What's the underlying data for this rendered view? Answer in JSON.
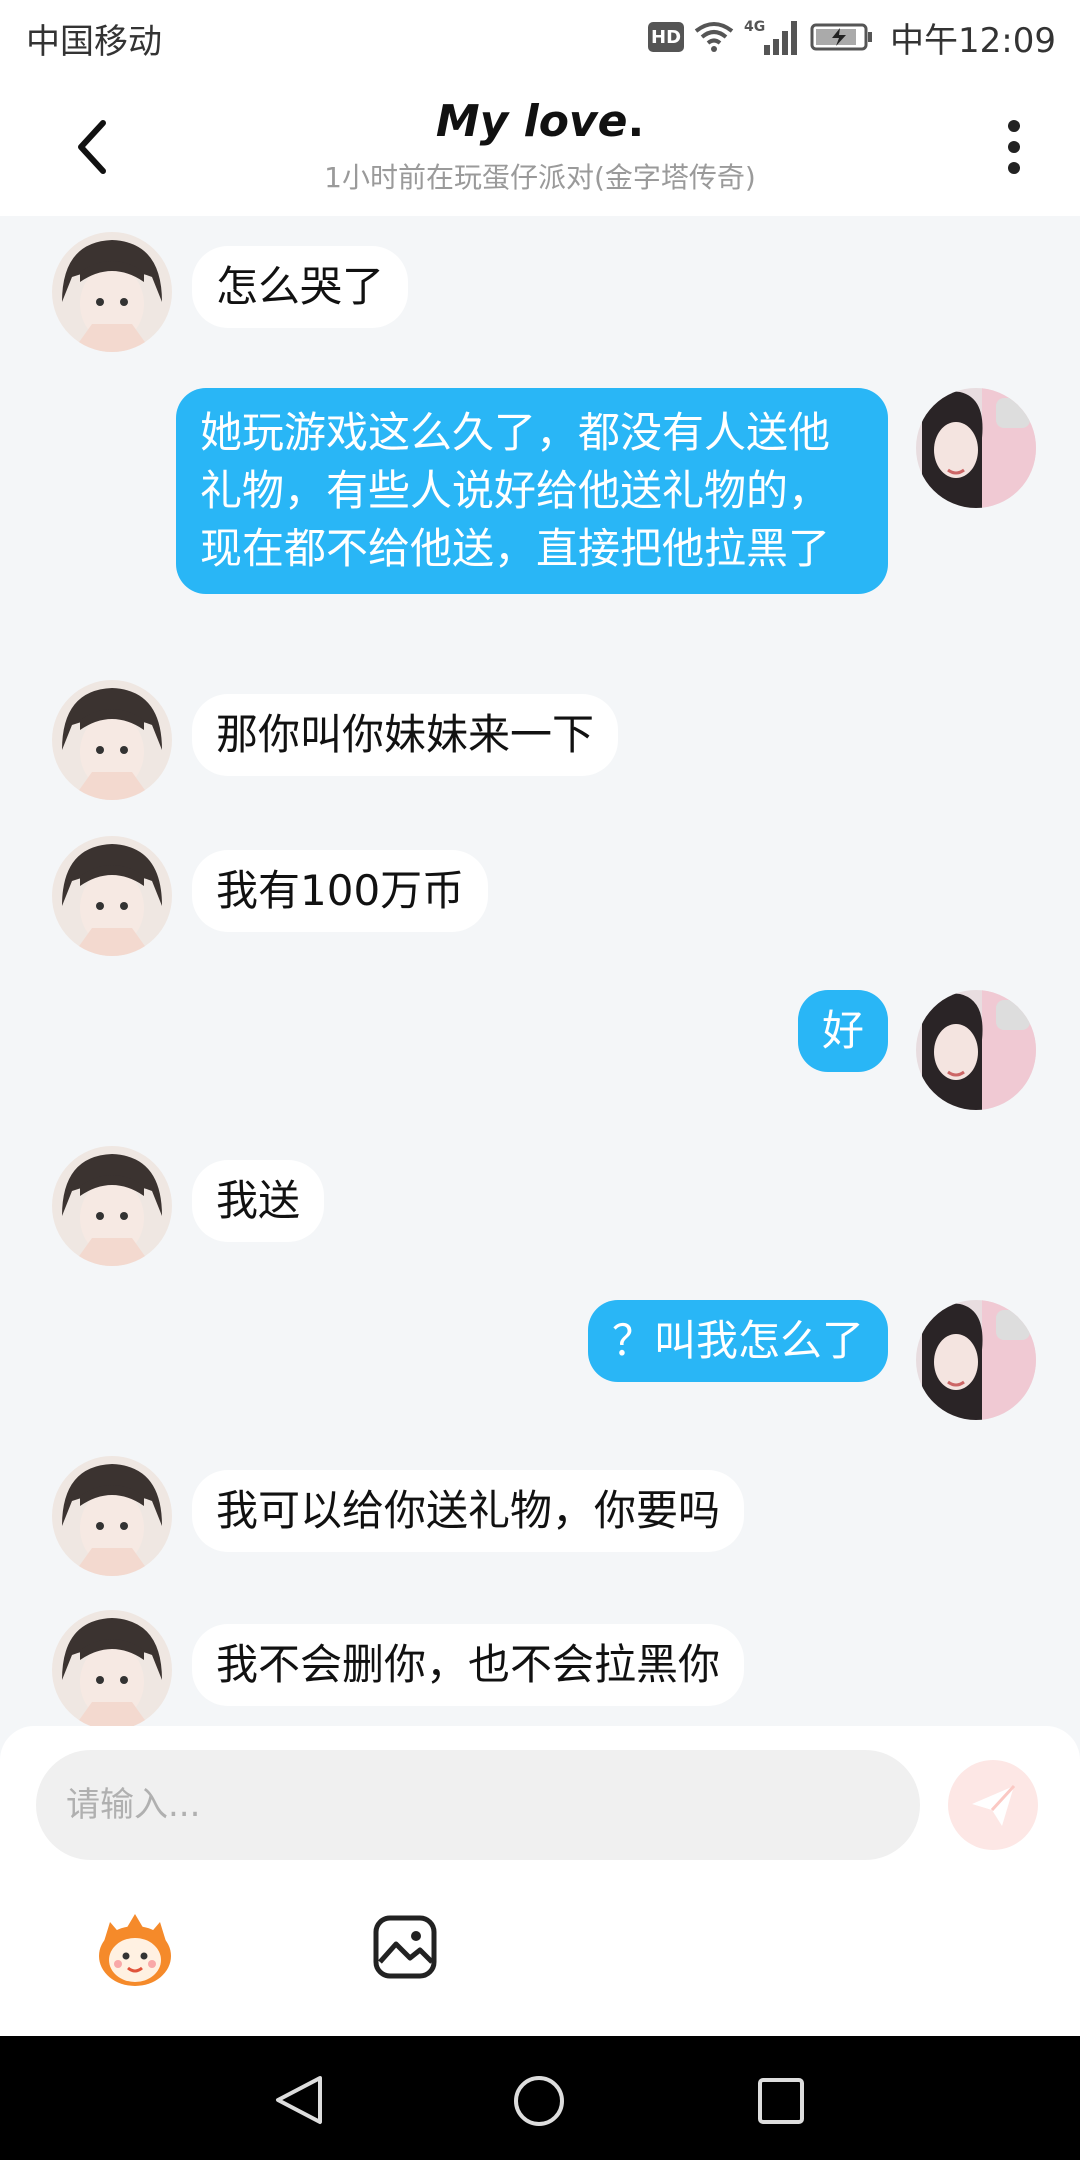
{
  "status_bar": {
    "carrier": "中国移动",
    "hd": "HD",
    "network": "4G",
    "time": "中午12:09"
  },
  "header": {
    "title": "My love",
    "title_suffix": ".",
    "subtitle": "1小时前在玩蛋仔派对(金字塔传奇)"
  },
  "messages": [
    {
      "side": "in",
      "text": "怎么哭了"
    },
    {
      "side": "out",
      "text": "她玩游戏这么久了，都没有人送他礼物，有些人说好给他送礼物的，现在都不给他送，直接把他拉黑了"
    },
    {
      "side": "in",
      "text": "那你叫你妹妹来一下"
    },
    {
      "side": "in",
      "text": "我有100万币"
    },
    {
      "side": "out",
      "text": "好"
    },
    {
      "side": "in",
      "text": "我送"
    },
    {
      "side": "out",
      "text": "？叫我怎么了"
    },
    {
      "side": "in",
      "text": "我可以给你送礼物，你要吗"
    },
    {
      "side": "in",
      "text": "我不会删你，也不会拉黑你"
    }
  ],
  "input": {
    "placeholder": "请输入..."
  },
  "icons": {
    "back": "chevron-left-icon",
    "more": "more-vertical-icon",
    "send": "send-icon",
    "emoji": "mascot-emoji-icon",
    "image": "image-icon"
  },
  "colors": {
    "outgoing_bubble": "#29b6f6",
    "incoming_bubble": "#ffffff",
    "background": "#f4f6f8",
    "send_button": "#fde7e5"
  }
}
